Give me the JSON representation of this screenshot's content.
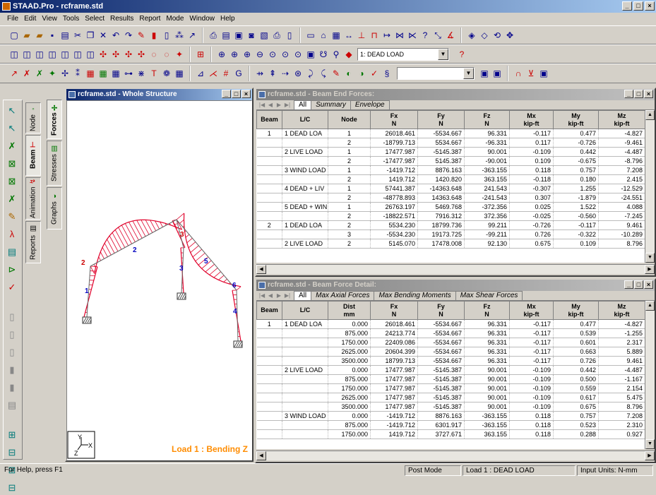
{
  "app": {
    "title": "STAAD.Pro - rcframe.std",
    "window_buttons": [
      "_",
      "□",
      "×"
    ]
  },
  "menu": [
    "File",
    "Edit",
    "View",
    "Tools",
    "Select",
    "Results",
    "Report",
    "Mode",
    "Window",
    "Help"
  ],
  "toolbar": {
    "load_case_combo": "1: DEAD LOAD"
  },
  "left_tabs": {
    "outer": [
      {
        "label": "Node"
      },
      {
        "label": "Beam"
      },
      {
        "label": "Animation"
      },
      {
        "label": "Reports"
      }
    ],
    "inner": [
      {
        "label": "Forces"
      },
      {
        "label": "Stresses"
      },
      {
        "label": "Graphs"
      }
    ]
  },
  "structure_window": {
    "title": "rcframe.std - Whole Structure",
    "caption": "Load 1 : Bending Z",
    "caption_color": "#ff8c00",
    "diagram_color": "#e0002a",
    "member_labels": [
      "1",
      "2",
      "3",
      "4",
      "5",
      "6"
    ],
    "axis_labels": {
      "y": "Y",
      "x": "X",
      "z": "Z"
    }
  },
  "beam_end_forces": {
    "title": "rcframe.std - Beam End Forces:",
    "tabs": [
      "All",
      "Summary",
      "Envelope"
    ],
    "columns": [
      {
        "name": "Beam",
        "unit": ""
      },
      {
        "name": "L/C",
        "unit": ""
      },
      {
        "name": "Node",
        "unit": ""
      },
      {
        "name": "Fx",
        "unit": "N"
      },
      {
        "name": "Fy",
        "unit": "N"
      },
      {
        "name": "Fz",
        "unit": "N"
      },
      {
        "name": "Mx",
        "unit": "kip-ft"
      },
      {
        "name": "My",
        "unit": "kip-ft"
      },
      {
        "name": "Mz",
        "unit": "kip-ft"
      }
    ],
    "rows": [
      [
        "1",
        "1 DEAD LOA",
        "1",
        "26018.461",
        "-5534.667",
        "96.331",
        "-0.117",
        "0.477",
        "-4.827"
      ],
      [
        "",
        "",
        "2",
        "-18799.713",
        "5534.667",
        "-96.331",
        "0.117",
        "-0.726",
        "-9.461"
      ],
      [
        "",
        "2 LIVE LOAD",
        "1",
        "17477.987",
        "-5145.387",
        "90.001",
        "-0.109",
        "0.442",
        "-4.487"
      ],
      [
        "",
        "",
        "2",
        "-17477.987",
        "5145.387",
        "-90.001",
        "0.109",
        "-0.675",
        "-8.796"
      ],
      [
        "",
        "3 WIND LOAD",
        "1",
        "-1419.712",
        "8876.163",
        "-363.155",
        "0.118",
        "0.757",
        "7.208"
      ],
      [
        "",
        "",
        "2",
        "1419.712",
        "1420.820",
        "363.155",
        "-0.118",
        "0.180",
        "2.415"
      ],
      [
        "",
        "4 DEAD + LIV",
        "1",
        "57441.387",
        "-14363.648",
        "241.543",
        "-0.307",
        "1.255",
        "-12.529"
      ],
      [
        "",
        "",
        "2",
        "-48778.893",
        "14363.648",
        "-241.543",
        "0.307",
        "-1.879",
        "-24.551"
      ],
      [
        "",
        "5 DEAD + WIN",
        "1",
        "26763.197",
        "5469.768",
        "-372.356",
        "0.025",
        "1.522",
        "4.088"
      ],
      [
        "",
        "",
        "2",
        "-18822.571",
        "7916.312",
        "372.356",
        "-0.025",
        "-0.560",
        "-7.245"
      ],
      [
        "2",
        "1 DEAD LOA",
        "2",
        "5534.230",
        "18799.736",
        "99.211",
        "-0.726",
        "-0.117",
        "9.461"
      ],
      [
        "",
        "",
        "3",
        "-5534.230",
        "19173.725",
        "-99.211",
        "0.726",
        "-0.322",
        "-10.289"
      ],
      [
        "",
        "2 LIVE LOAD",
        "2",
        "5145.070",
        "17478.008",
        "92.130",
        "0.675",
        "0.109",
        "8.796"
      ]
    ]
  },
  "beam_force_detail": {
    "title": "rcframe.std - Beam Force Detail:",
    "tabs": [
      "All",
      "Max Axial Forces",
      "Max Bending Moments",
      "Max Shear Forces"
    ],
    "columns": [
      {
        "name": "Beam",
        "unit": ""
      },
      {
        "name": "L/C",
        "unit": ""
      },
      {
        "name": "Dist",
        "unit": "mm"
      },
      {
        "name": "Fx",
        "unit": "N"
      },
      {
        "name": "Fy",
        "unit": "N"
      },
      {
        "name": "Fz",
        "unit": "N"
      },
      {
        "name": "Mx",
        "unit": "kip-ft"
      },
      {
        "name": "My",
        "unit": "kip-ft"
      },
      {
        "name": "Mz",
        "unit": "kip-ft"
      }
    ],
    "rows": [
      [
        "1",
        "1 DEAD LOA",
        "0.000",
        "26018.461",
        "-5534.667",
        "96.331",
        "-0.117",
        "0.477",
        "-4.827"
      ],
      [
        "",
        "",
        "875.000",
        "24213.774",
        "-5534.667",
        "96.331",
        "-0.117",
        "0.539",
        "-1.255"
      ],
      [
        "",
        "",
        "1750.000",
        "22409.086",
        "-5534.667",
        "96.331",
        "-0.117",
        "0.601",
        "2.317"
      ],
      [
        "",
        "",
        "2625.000",
        "20604.399",
        "-5534.667",
        "96.331",
        "-0.117",
        "0.663",
        "5.889"
      ],
      [
        "",
        "",
        "3500.000",
        "18799.713",
        "-5534.667",
        "96.331",
        "-0.117",
        "0.726",
        "9.461"
      ],
      [
        "",
        "2 LIVE LOAD",
        "0.000",
        "17477.987",
        "-5145.387",
        "90.001",
        "-0.109",
        "0.442",
        "-4.487"
      ],
      [
        "",
        "",
        "875.000",
        "17477.987",
        "-5145.387",
        "90.001",
        "-0.109",
        "0.500",
        "-1.167"
      ],
      [
        "",
        "",
        "1750.000",
        "17477.987",
        "-5145.387",
        "90.001",
        "-0.109",
        "0.559",
        "2.154"
      ],
      [
        "",
        "",
        "2625.000",
        "17477.987",
        "-5145.387",
        "90.001",
        "-0.109",
        "0.617",
        "5.475"
      ],
      [
        "",
        "",
        "3500.000",
        "17477.987",
        "-5145.387",
        "90.001",
        "-0.109",
        "0.675",
        "8.796"
      ],
      [
        "",
        "3 WIND LOAD",
        "0.000",
        "-1419.712",
        "8876.163",
        "-363.155",
        "0.118",
        "0.757",
        "7.208"
      ],
      [
        "",
        "",
        "875.000",
        "-1419.712",
        "6301.917",
        "-363.155",
        "0.118",
        "0.523",
        "2.310"
      ],
      [
        "",
        "",
        "1750.000",
        "1419.712",
        "3727.671",
        "363.155",
        "0.118",
        "0.288",
        "0.927"
      ]
    ]
  },
  "status": {
    "help": "For Help, press F1",
    "mode": "Post Mode",
    "load": "Load 1 : DEAD LOAD",
    "units_label": "Input Units:",
    "units": "N-mm"
  }
}
